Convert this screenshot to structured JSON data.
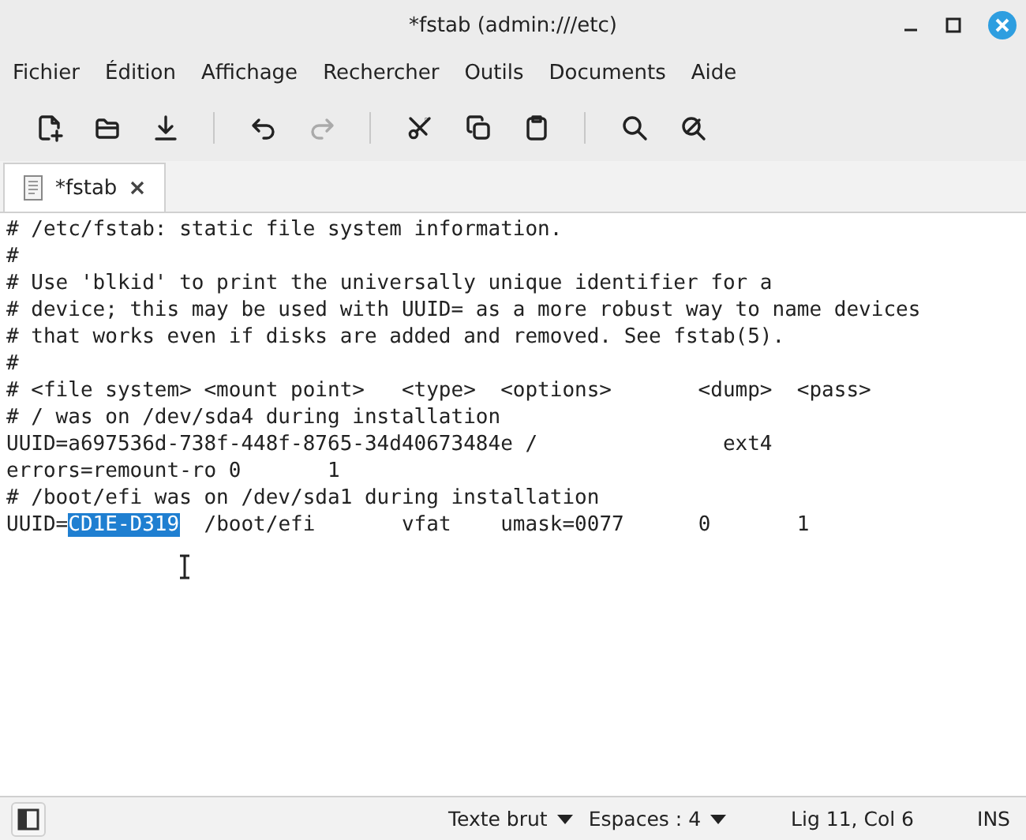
{
  "window": {
    "title": "*fstab (admin:///etc)"
  },
  "menu": [
    "Fichier",
    "Édition",
    "Affichage",
    "Rechercher",
    "Outils",
    "Documents",
    "Aide"
  ],
  "toolbar": [
    {
      "kind": "button",
      "disabled": false
    },
    {
      "kind": "button",
      "disabled": false
    },
    {
      "kind": "button",
      "disabled": false
    },
    {
      "kind": "separator"
    },
    {
      "kind": "button",
      "disabled": false
    },
    {
      "kind": "button",
      "disabled": true
    },
    {
      "kind": "separator"
    },
    {
      "kind": "button",
      "disabled": false
    },
    {
      "kind": "button",
      "disabled": false
    },
    {
      "kind": "button",
      "disabled": false
    },
    {
      "kind": "separator"
    },
    {
      "kind": "button",
      "disabled": false
    },
    {
      "kind": "button",
      "disabled": false
    }
  ],
  "tabs": [
    {
      "label": "*fstab",
      "selected": true
    }
  ],
  "editor": {
    "lines": [
      {
        "segments": [
          {
            "text": "# /etc/fstab: static file system information.",
            "selected": false
          }
        ]
      },
      {
        "segments": [
          {
            "text": "#",
            "selected": false
          }
        ]
      },
      {
        "segments": [
          {
            "text": "# Use 'blkid' to print the universally unique identifier for a",
            "selected": false
          }
        ]
      },
      {
        "segments": [
          {
            "text": "# device; this may be used with UUID= as a more robust way to name devices",
            "selected": false
          }
        ]
      },
      {
        "segments": [
          {
            "text": "# that works even if disks are added and removed. See fstab(5).",
            "selected": false
          }
        ]
      },
      {
        "segments": [
          {
            "text": "#",
            "selected": false
          }
        ]
      },
      {
        "segments": [
          {
            "text": "# <file system> <mount point>   <type>  <options>       <dump>  <pass>",
            "selected": false
          }
        ]
      },
      {
        "segments": [
          {
            "text": "# / was on /dev/sda4 during installation",
            "selected": false
          }
        ]
      },
      {
        "segments": [
          {
            "text": "UUID=a697536d-738f-448f-8765-34d40673484e /               ext4",
            "selected": false
          }
        ]
      },
      {
        "segments": [
          {
            "text": "errors=remount-ro 0       1",
            "selected": false
          }
        ]
      },
      {
        "segments": [
          {
            "text": "# /boot/efi was on /dev/sda1 during installation",
            "selected": false
          }
        ]
      },
      {
        "segments": [
          {
            "text": "UUID=",
            "selected": false
          },
          {
            "text": "CD1E-D319",
            "selected": true
          },
          {
            "text": "  /boot/efi       vfat    umask=0077      0       1",
            "selected": false
          }
        ]
      }
    ]
  },
  "status_bar": {
    "language": "Texte brut",
    "indent": "Espaces : 4",
    "position": "Lig 11, Col 6",
    "mode": "INS"
  }
}
